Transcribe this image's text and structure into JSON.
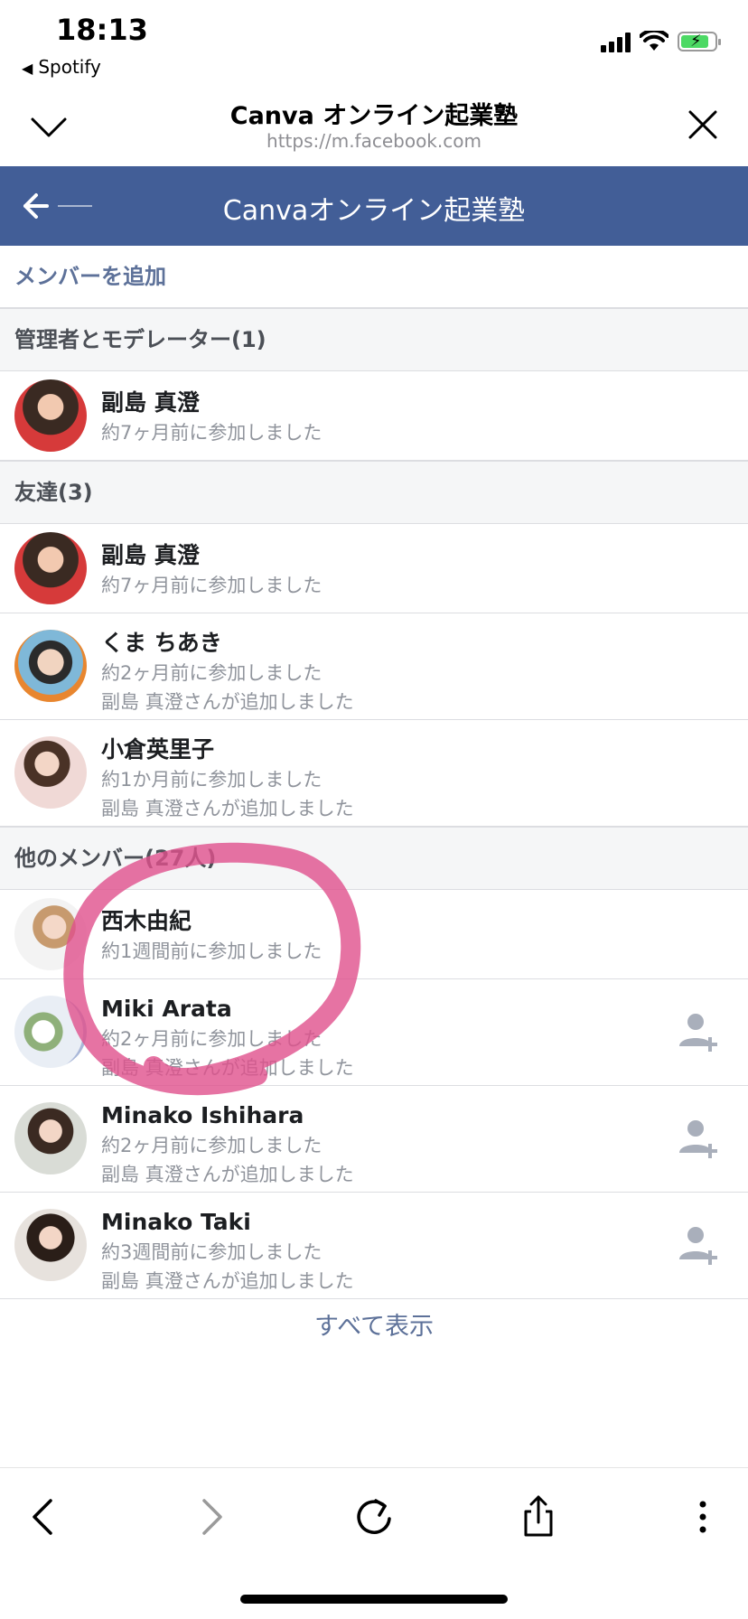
{
  "status_bar": {
    "time": "18:13",
    "back_app": "Spotify"
  },
  "browser_header": {
    "title": "Canva オンライン起業塾",
    "url": "https://m.facebook.com",
    "down_icon": "chevron-down-icon",
    "close_icon": "close-icon"
  },
  "fb_nav": {
    "title": "Canvaオンライン起業塾",
    "back_icon": "back-arrow-icon"
  },
  "add_member_label": "メンバーを追加",
  "sections": {
    "admins": {
      "title": "管理者とモデレーター(1)",
      "members": [
        {
          "name": "副島 真澄",
          "joined": "約7ヶ月前に参加しました"
        }
      ]
    },
    "friends": {
      "title": "友達(3)",
      "members": [
        {
          "name": "副島 真澄",
          "joined": "約7ヶ月前に参加しました"
        },
        {
          "name": "くま ちあき",
          "joined": "約2ヶ月前に参加しました",
          "added_by": "副島 真澄さんが追加しました"
        },
        {
          "name": "小倉英里子",
          "joined": "約1か月前に参加しました",
          "added_by": "副島 真澄さんが追加しました"
        }
      ]
    },
    "others": {
      "title": "他のメンバー(27人)",
      "members": [
        {
          "name": "西木由紀",
          "joined": "約1週間前に参加しました"
        },
        {
          "name": "Miki Arata",
          "joined": "約2ヶ月前に参加しました",
          "added_by": "副島 真澄さんが追加しました"
        },
        {
          "name": "Minako Ishihara",
          "joined": "約2ヶ月前に参加しました",
          "added_by": "副島 真澄さんが追加しました"
        },
        {
          "name": "Minako Taki",
          "joined": "約3週間前に参加しました",
          "added_by": "副島 真澄さんが追加しました"
        }
      ]
    }
  },
  "show_all_label": "すべて表示",
  "toolbar": {
    "icons": [
      "back-icon",
      "forward-icon",
      "reload-icon",
      "share-icon",
      "more-icon"
    ]
  },
  "colors": {
    "fb_blue": "#425e97",
    "link_blue": "#5d7199",
    "annotation_pink": "#e0508c"
  }
}
